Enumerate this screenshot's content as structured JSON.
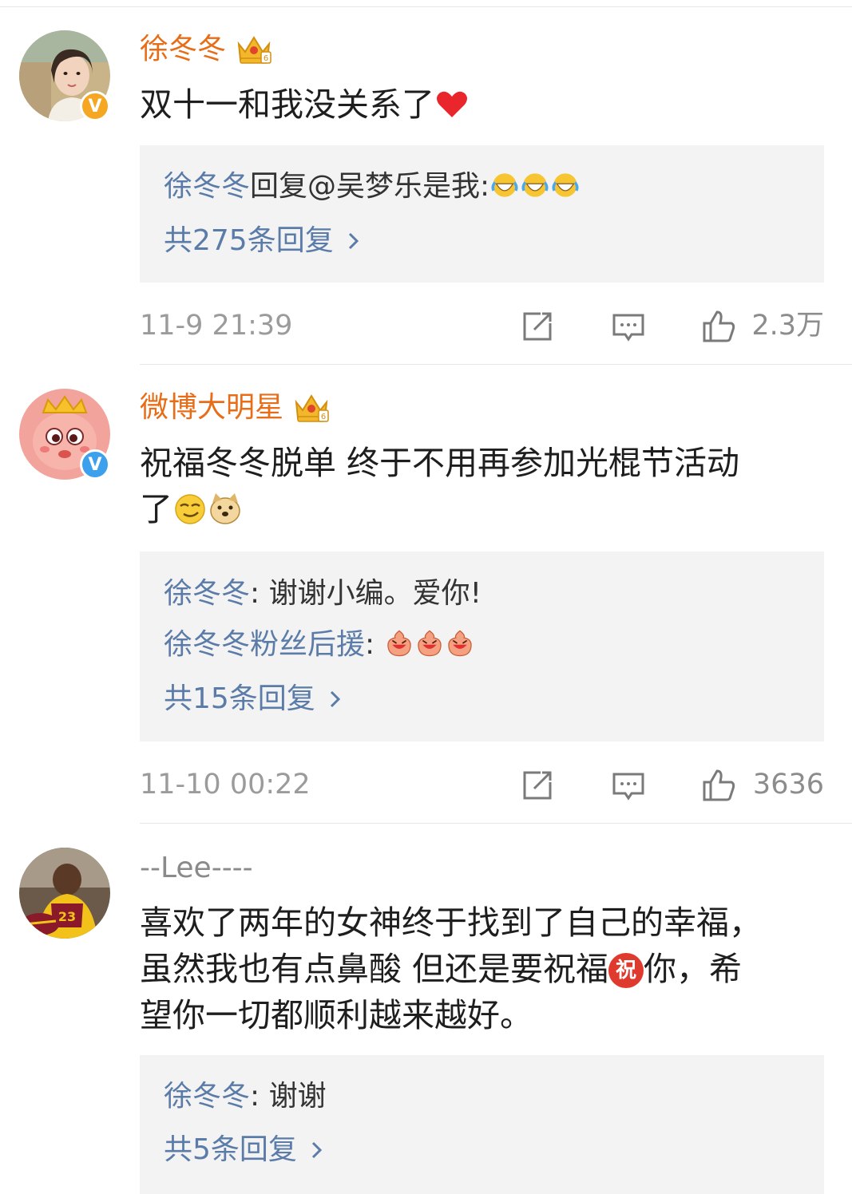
{
  "comments": [
    {
      "username": "徐冬冬",
      "text": "双十一和我没关系了",
      "text_emoji": "heart-icon",
      "verified": "orange",
      "replies": [
        {
          "user": "徐冬冬",
          "text": "回复@吴梦乐是我:",
          "emojis": [
            "laugh-cry-emoji",
            "laugh-cry-emoji",
            "laugh-cry-emoji"
          ]
        }
      ],
      "more_replies": "共275条回复",
      "timestamp": "11-9 21:39",
      "likes": "2.3万"
    },
    {
      "username": "微博大明星",
      "text_line1": "祝福冬冬脱单 终于不用再参加光棍节活动",
      "text_line2": "了",
      "text_emojis": [
        "smirk-emoji",
        "doge-emoji"
      ],
      "verified": "blue",
      "replies": [
        {
          "user": "徐冬冬",
          "text": ": 谢谢小编。爱你!"
        },
        {
          "user": "徐冬冬粉丝后援",
          "text": ": ",
          "emojis": [
            "cute-laugh-emoji",
            "cute-laugh-emoji",
            "cute-laugh-emoji"
          ]
        }
      ],
      "more_replies": "共15条回复",
      "timestamp": "11-10 00:22",
      "likes": "3636"
    },
    {
      "username": "--Lee----",
      "text_line1": "喜欢了两年的女神终于找到了自己的幸福，",
      "text_line2a": "虽然我也有点鼻酸 但还是要祝福",
      "text_badge": "祝",
      "text_line2b": "你，希",
      "text_line3": "望你一切都顺利越来越好。",
      "replies": [
        {
          "user": "徐冬冬",
          "text": ": 谢谢"
        }
      ],
      "more_replies": "共5条回复"
    }
  ],
  "colors": {
    "username": "#e86d18",
    "reply_user": "#5b7ca8",
    "timestamp": "#9b9b9b",
    "reply_bg": "#f3f3f3"
  }
}
